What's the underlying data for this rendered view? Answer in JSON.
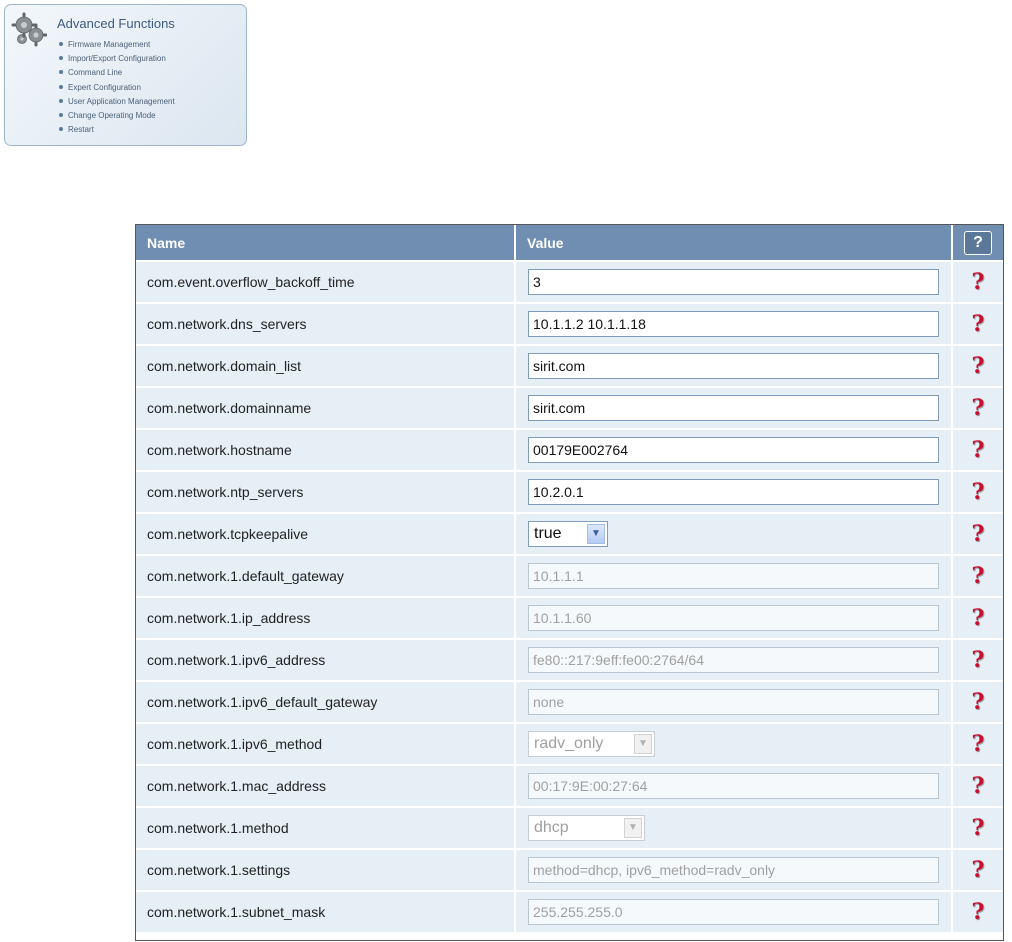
{
  "advanced": {
    "title": "Advanced Functions",
    "items": [
      "Firmware Management",
      "Import/Export Configuration",
      "Command Line",
      "Expert Configuration",
      "User Application Management",
      "Change Operating Mode",
      "Restart"
    ]
  },
  "table": {
    "header": {
      "name": "Name",
      "value": "Value",
      "help": "?"
    },
    "help_mark": "?",
    "rows": [
      {
        "name": "com.event.overflow_backoff_time",
        "type": "text",
        "value": "3",
        "disabled": false
      },
      {
        "name": "com.network.dns_servers",
        "type": "text",
        "value": "10.1.1.2 10.1.1.18",
        "disabled": false
      },
      {
        "name": "com.network.domain_list",
        "type": "text",
        "value": "sirit.com",
        "disabled": false
      },
      {
        "name": "com.network.domainname",
        "type": "text",
        "value": "sirit.com",
        "disabled": false
      },
      {
        "name": "com.network.hostname",
        "type": "text",
        "value": "00179E002764",
        "disabled": false
      },
      {
        "name": "com.network.ntp_servers",
        "type": "text",
        "value": "10.2.0.1",
        "disabled": false
      },
      {
        "name": "com.network.tcpkeepalive",
        "type": "select",
        "value": "true",
        "disabled": false
      },
      {
        "name": "com.network.1.default_gateway",
        "type": "text",
        "value": "10.1.1.1",
        "disabled": true
      },
      {
        "name": "com.network.1.ip_address",
        "type": "text",
        "value": "10.1.1.60",
        "disabled": true
      },
      {
        "name": "com.network.1.ipv6_address",
        "type": "text",
        "value": "fe80::217:9eff:fe00:2764/64",
        "disabled": true
      },
      {
        "name": "com.network.1.ipv6_default_gateway",
        "type": "text",
        "value": "none",
        "disabled": true
      },
      {
        "name": "com.network.1.ipv6_method",
        "type": "select",
        "value": "radv_only",
        "disabled": true
      },
      {
        "name": "com.network.1.mac_address",
        "type": "text",
        "value": "00:17:9E:00:27:64",
        "disabled": true
      },
      {
        "name": "com.network.1.method",
        "type": "select",
        "value": "dhcp",
        "disabled": true
      },
      {
        "name": "com.network.1.settings",
        "type": "text",
        "value": "method=dhcp, ipv6_method=radv_only",
        "disabled": true
      },
      {
        "name": "com.network.1.subnet_mask",
        "type": "text",
        "value": "255.255.255.0",
        "disabled": true
      }
    ]
  },
  "colors": {
    "header_bg": "#6f8eb2",
    "row_bg": "#e6eef6",
    "help_red": "#c8102e"
  }
}
